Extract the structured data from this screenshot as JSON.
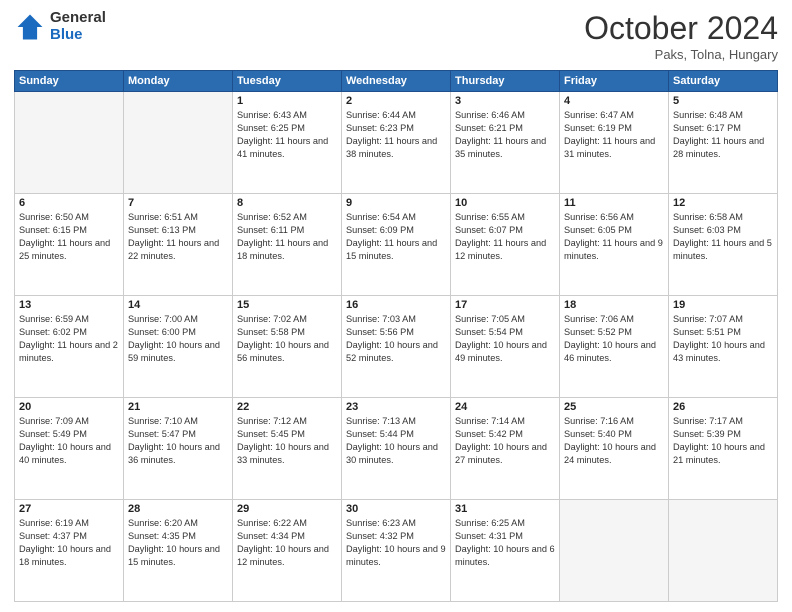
{
  "header": {
    "logo_general": "General",
    "logo_blue": "Blue",
    "title": "October 2024",
    "location": "Paks, Tolna, Hungary"
  },
  "weekdays": [
    "Sunday",
    "Monday",
    "Tuesday",
    "Wednesday",
    "Thursday",
    "Friday",
    "Saturday"
  ],
  "weeks": [
    [
      {
        "day": "",
        "info": ""
      },
      {
        "day": "",
        "info": ""
      },
      {
        "day": "1",
        "info": "Sunrise: 6:43 AM\nSunset: 6:25 PM\nDaylight: 11 hours and 41 minutes."
      },
      {
        "day": "2",
        "info": "Sunrise: 6:44 AM\nSunset: 6:23 PM\nDaylight: 11 hours and 38 minutes."
      },
      {
        "day": "3",
        "info": "Sunrise: 6:46 AM\nSunset: 6:21 PM\nDaylight: 11 hours and 35 minutes."
      },
      {
        "day": "4",
        "info": "Sunrise: 6:47 AM\nSunset: 6:19 PM\nDaylight: 11 hours and 31 minutes."
      },
      {
        "day": "5",
        "info": "Sunrise: 6:48 AM\nSunset: 6:17 PM\nDaylight: 11 hours and 28 minutes."
      }
    ],
    [
      {
        "day": "6",
        "info": "Sunrise: 6:50 AM\nSunset: 6:15 PM\nDaylight: 11 hours and 25 minutes."
      },
      {
        "day": "7",
        "info": "Sunrise: 6:51 AM\nSunset: 6:13 PM\nDaylight: 11 hours and 22 minutes."
      },
      {
        "day": "8",
        "info": "Sunrise: 6:52 AM\nSunset: 6:11 PM\nDaylight: 11 hours and 18 minutes."
      },
      {
        "day": "9",
        "info": "Sunrise: 6:54 AM\nSunset: 6:09 PM\nDaylight: 11 hours and 15 minutes."
      },
      {
        "day": "10",
        "info": "Sunrise: 6:55 AM\nSunset: 6:07 PM\nDaylight: 11 hours and 12 minutes."
      },
      {
        "day": "11",
        "info": "Sunrise: 6:56 AM\nSunset: 6:05 PM\nDaylight: 11 hours and 9 minutes."
      },
      {
        "day": "12",
        "info": "Sunrise: 6:58 AM\nSunset: 6:03 PM\nDaylight: 11 hours and 5 minutes."
      }
    ],
    [
      {
        "day": "13",
        "info": "Sunrise: 6:59 AM\nSunset: 6:02 PM\nDaylight: 11 hours and 2 minutes."
      },
      {
        "day": "14",
        "info": "Sunrise: 7:00 AM\nSunset: 6:00 PM\nDaylight: 10 hours and 59 minutes."
      },
      {
        "day": "15",
        "info": "Sunrise: 7:02 AM\nSunset: 5:58 PM\nDaylight: 10 hours and 56 minutes."
      },
      {
        "day": "16",
        "info": "Sunrise: 7:03 AM\nSunset: 5:56 PM\nDaylight: 10 hours and 52 minutes."
      },
      {
        "day": "17",
        "info": "Sunrise: 7:05 AM\nSunset: 5:54 PM\nDaylight: 10 hours and 49 minutes."
      },
      {
        "day": "18",
        "info": "Sunrise: 7:06 AM\nSunset: 5:52 PM\nDaylight: 10 hours and 46 minutes."
      },
      {
        "day": "19",
        "info": "Sunrise: 7:07 AM\nSunset: 5:51 PM\nDaylight: 10 hours and 43 minutes."
      }
    ],
    [
      {
        "day": "20",
        "info": "Sunrise: 7:09 AM\nSunset: 5:49 PM\nDaylight: 10 hours and 40 minutes."
      },
      {
        "day": "21",
        "info": "Sunrise: 7:10 AM\nSunset: 5:47 PM\nDaylight: 10 hours and 36 minutes."
      },
      {
        "day": "22",
        "info": "Sunrise: 7:12 AM\nSunset: 5:45 PM\nDaylight: 10 hours and 33 minutes."
      },
      {
        "day": "23",
        "info": "Sunrise: 7:13 AM\nSunset: 5:44 PM\nDaylight: 10 hours and 30 minutes."
      },
      {
        "day": "24",
        "info": "Sunrise: 7:14 AM\nSunset: 5:42 PM\nDaylight: 10 hours and 27 minutes."
      },
      {
        "day": "25",
        "info": "Sunrise: 7:16 AM\nSunset: 5:40 PM\nDaylight: 10 hours and 24 minutes."
      },
      {
        "day": "26",
        "info": "Sunrise: 7:17 AM\nSunset: 5:39 PM\nDaylight: 10 hours and 21 minutes."
      }
    ],
    [
      {
        "day": "27",
        "info": "Sunrise: 6:19 AM\nSunset: 4:37 PM\nDaylight: 10 hours and 18 minutes."
      },
      {
        "day": "28",
        "info": "Sunrise: 6:20 AM\nSunset: 4:35 PM\nDaylight: 10 hours and 15 minutes."
      },
      {
        "day": "29",
        "info": "Sunrise: 6:22 AM\nSunset: 4:34 PM\nDaylight: 10 hours and 12 minutes."
      },
      {
        "day": "30",
        "info": "Sunrise: 6:23 AM\nSunset: 4:32 PM\nDaylight: 10 hours and 9 minutes."
      },
      {
        "day": "31",
        "info": "Sunrise: 6:25 AM\nSunset: 4:31 PM\nDaylight: 10 hours and 6 minutes."
      },
      {
        "day": "",
        "info": ""
      },
      {
        "day": "",
        "info": ""
      }
    ]
  ]
}
